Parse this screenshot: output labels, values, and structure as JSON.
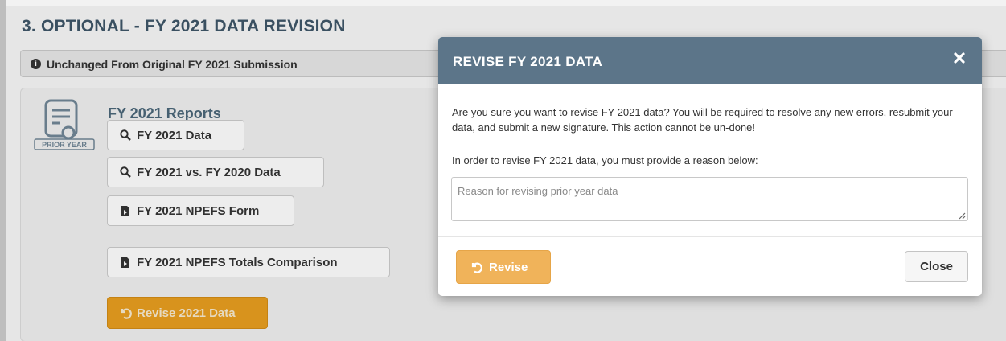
{
  "section": {
    "title": "3. OPTIONAL - FY 2021 DATA REVISION",
    "status_text": "Unchanged From Original FY 2021 Submission",
    "status_icon": "info-icon"
  },
  "reports": {
    "title": "FY 2021 Reports",
    "icon_badge": "PRIOR YEAR",
    "buttons": [
      {
        "label": "FY 2021 Data",
        "icon": "search-icon"
      },
      {
        "label": "FY 2021 vs. FY 2020 Data",
        "icon": "search-icon"
      },
      {
        "label": "FY 2021 NPEFS Form",
        "icon": "file-pdf-icon"
      },
      {
        "label": "FY 2021 NPEFS Totals Comparison",
        "icon": "file-pdf-icon"
      }
    ],
    "revise_button": "Revise 2021 Data"
  },
  "modal": {
    "title": "REVISE FY 2021 DATA",
    "body": "Are you sure you want to revise FY 2021 data? You will be required to resolve any new errors, resubmit your data, and submit a new signature. This action cannot be un-done!",
    "reason_label": "In order to revise FY 2021 data, you must provide a reason below:",
    "reason_value": "",
    "reason_placeholder": "Reason for revising prior year data",
    "revise_button": "Revise",
    "close_button": "Close"
  },
  "colors": {
    "header": "#5c7589",
    "revise_orange": "#f0b35a",
    "section_title": "#3e5567"
  }
}
